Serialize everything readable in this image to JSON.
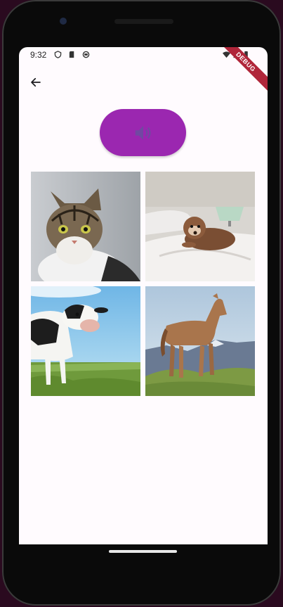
{
  "status_bar": {
    "time": "9:32",
    "icons": [
      "shield-icon",
      "sd-card-icon",
      "app-icon",
      "wifi-icon",
      "signal-icon",
      "battery-icon"
    ]
  },
  "app_bar": {
    "back_icon": "arrow-left-icon",
    "debug_banner": "DEBUG"
  },
  "sound_button": {
    "icon": "volume-icon",
    "color": "#9b27b0"
  },
  "animal_grid": {
    "items": [
      {
        "animal": "cat",
        "image_icon": "cat-image"
      },
      {
        "animal": "dog",
        "image_icon": "dog-image"
      },
      {
        "animal": "cow",
        "image_icon": "cow-image"
      },
      {
        "animal": "horse",
        "image_icon": "horse-image"
      }
    ]
  },
  "colors": {
    "screen_bg": "#fffbfe",
    "accent": "#9b27b0"
  }
}
